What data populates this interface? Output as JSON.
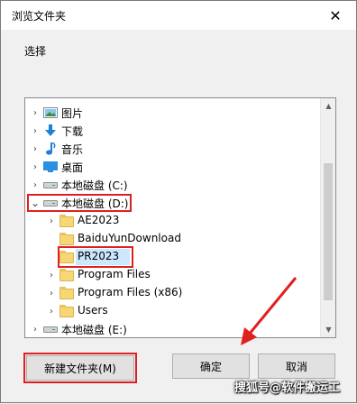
{
  "window": {
    "title": "浏览文件夹",
    "close_glyph": "✕"
  },
  "prompt": "选择",
  "tree": {
    "items": [
      {
        "label": "图片",
        "icon": "pictures-icon",
        "expander": "›",
        "level": 1
      },
      {
        "label": "下载",
        "icon": "downloads-icon",
        "expander": "›",
        "level": 1
      },
      {
        "label": "音乐",
        "icon": "music-icon",
        "expander": "›",
        "level": 1
      },
      {
        "label": "桌面",
        "icon": "desktop-icon",
        "expander": "›",
        "level": 1
      },
      {
        "label": "本地磁盘 (C:)",
        "icon": "drive-icon",
        "expander": "›",
        "level": 1
      },
      {
        "label": "本地磁盘 (D:)",
        "icon": "drive-icon",
        "expander": "⌄",
        "level": 1,
        "expanded": true
      },
      {
        "label": "AE2023",
        "icon": "folder-icon",
        "expander": "›",
        "level": 2
      },
      {
        "label": "BaiduYunDownload",
        "icon": "folder-icon",
        "expander": "",
        "level": 2
      },
      {
        "label": "PR2023",
        "icon": "folder-icon",
        "expander": "",
        "level": 2,
        "selected": true
      },
      {
        "label": "Program Files",
        "icon": "folder-icon",
        "expander": "›",
        "level": 2
      },
      {
        "label": "Program Files (x86)",
        "icon": "folder-icon",
        "expander": "›",
        "level": 2
      },
      {
        "label": "Users",
        "icon": "folder-icon",
        "expander": "›",
        "level": 2
      },
      {
        "label": "本地磁盘 (E:)",
        "icon": "drive-icon",
        "expander": "›",
        "level": 1
      }
    ]
  },
  "buttons": {
    "new_folder": "新建文件夹(M)",
    "ok": "确定",
    "cancel": "取消"
  },
  "watermark": "搜狐号@软件搬运工",
  "colors": {
    "annotation": "#e02020",
    "accent_blue": "#1e7fd8"
  }
}
